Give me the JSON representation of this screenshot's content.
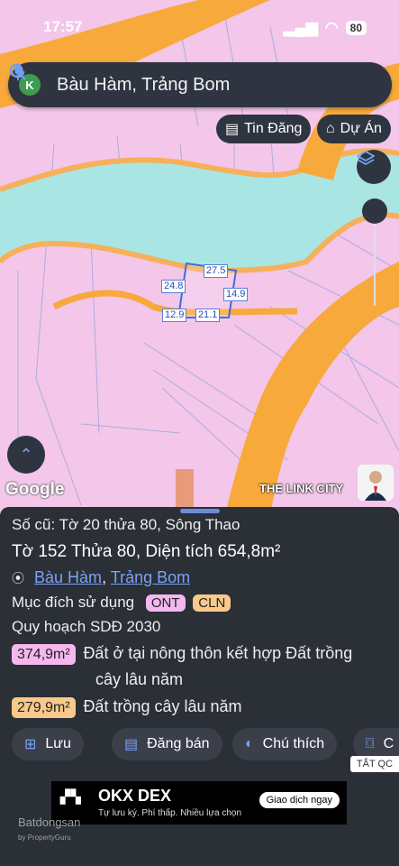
{
  "status_bar": {
    "time": "17:57",
    "battery": "80"
  },
  "search": {
    "avatar_letter": "K",
    "query": "Bàu Hàm, Trảng Bom"
  },
  "chips": {
    "tin_dang": "Tin Đăng",
    "du_an": "Dự Án"
  },
  "map": {
    "dimensions": [
      "27.5",
      "24.8",
      "14.9",
      "12.9",
      "21.1"
    ],
    "google_label": "Google",
    "place_label": "THE LINK CITY"
  },
  "panel": {
    "old_parcel": "Số cũ: Tờ 20 thửa 80, Sông Thao",
    "parcel_info": "Tờ 152 Thửa 80, Diện tích 654,8m²",
    "location_commune": "Bàu Hàm",
    "location_sep": ", ",
    "location_district": "Trảng Bom",
    "purpose_label": "Mục đích sử dụng",
    "purpose_tags": [
      "ONT",
      "CLN"
    ],
    "plan_label": "Quy hoạch SDĐ 2030",
    "zones": [
      {
        "area": "374,9m²",
        "desc_line1": "Đất ở tại nông thôn kết hợp Đất trồng",
        "desc_line2": "cây lâu năm"
      },
      {
        "area": "279,9m²",
        "desc_line1": "Đất trồng cây lâu năm"
      }
    ],
    "buttons": [
      "Lưu",
      "Đăng bán",
      "Chú thích",
      "C"
    ],
    "tat_qc": "TẮT QC"
  },
  "ad": {
    "brand": "OKX DEX",
    "tagline": "Tự lưu ký. Phí thấp. Nhiều lựa chọn",
    "cta": "Giao dịch ngay"
  },
  "watermark": {
    "brand": "Batdongsan",
    "sub": "by PropertyGuru"
  },
  "colors": {
    "map_land": "#f3c6ea",
    "road": "#f8a93c",
    "water": "#a9e6e3",
    "tag_ont": "#f4b8ef",
    "tag_cln": "#f9c98a",
    "zone1": "#f4b8ef",
    "zone2": "#f9c98a",
    "panel_bg": "#2b2f36",
    "accent": "#7aa2f7"
  }
}
